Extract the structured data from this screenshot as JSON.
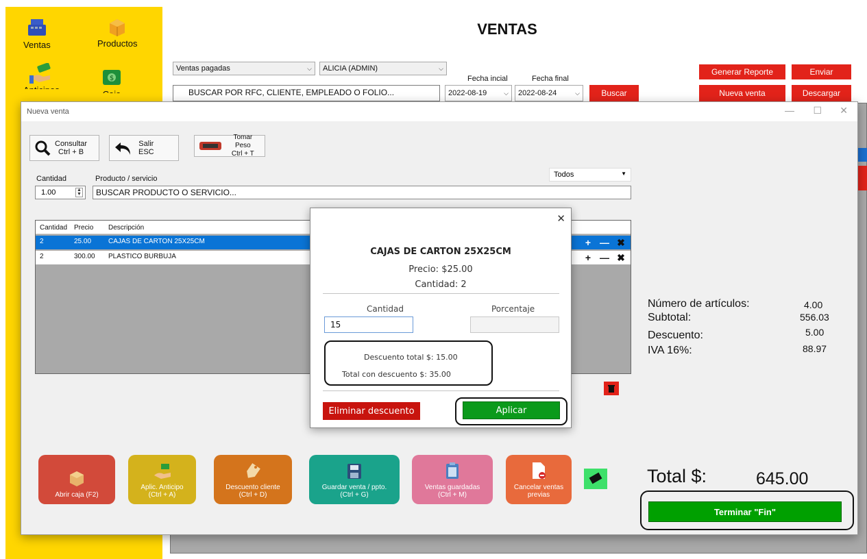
{
  "sidebar": {
    "items": [
      {
        "label": "Ventas",
        "icon": "cash-register-icon"
      },
      {
        "label": "Productos",
        "icon": "box-icon"
      },
      {
        "label": "Anticipos",
        "icon": "money-hand-icon"
      },
      {
        "label": "Caja",
        "icon": "cash-icon"
      }
    ]
  },
  "header": {
    "title": "VENTAS",
    "filter_select": "Ventas pagadas",
    "user_select": "ALICIA (ADMIN)",
    "search_placeholder": "BUSCAR POR RFC, CLIENTE, EMPLEADO O FOLIO...",
    "fecha_inicial_label": "Fecha incial",
    "fecha_final_label": "Fecha final",
    "fecha_inicial": "2022-08-19",
    "fecha_final": "2022-08-24",
    "buscar_label": "Buscar",
    "generar_reporte_label": "Generar Reporte",
    "enviar_label": "Enviar",
    "nueva_venta_label": "Nueva venta",
    "descargar_label": "Descargar"
  },
  "window": {
    "title": "Nueva venta",
    "toolbar": {
      "consultar_line1": "Consultar",
      "consultar_line2": "Ctrl + B",
      "salir_line1": "Salir",
      "salir_line2": "ESC",
      "peso_line1": "Tomar Peso",
      "peso_line2": "Ctrl + T"
    },
    "cantidad_label": "Cantidad",
    "cantidad_value": "1.00",
    "producto_label": "Producto / servicio",
    "producto_placeholder": "BUSCAR PRODUCTO O SERVICIO...",
    "categoria_select": "Todos",
    "grid": {
      "headers": [
        "Cantidad",
        "Precio",
        "Descripción"
      ],
      "rows": [
        {
          "cantidad": "2",
          "precio": "25.00",
          "descripcion": "CAJAS DE CARTON 25X25CM"
        },
        {
          "cantidad": "2",
          "precio": "300.00",
          "descripcion": "PLASTICO BURBUJA"
        }
      ]
    },
    "summary": {
      "articulos_label": "Número de artículos:",
      "articulos_value": "4.00",
      "subtotal_label": "Subtotal:",
      "subtotal_value": "556.03",
      "descuento_label": "Descuento:",
      "descuento_value": "5.00",
      "iva_label": "IVA 16%:",
      "iva_value": "88.97"
    },
    "actions": [
      {
        "line1": "Abrir caja (F2)",
        "line2": "",
        "color": "#d24a3a",
        "icon": "box-icon"
      },
      {
        "line1": "Aplic. Anticipo",
        "line2": "(Ctrl + A)",
        "color": "#d4b21c",
        "icon": "money-hand-icon"
      },
      {
        "line1": "Descuento cliente",
        "line2": "(Ctrl + D)",
        "color": "#d4741c",
        "icon": "tag-icon"
      },
      {
        "line1": "Guardar venta / ppto.",
        "line2": "(Ctrl + G)",
        "color": "#1aa38b",
        "icon": "save-icon"
      },
      {
        "line1": "Ventas guardadas",
        "line2": "(Ctrl + M)",
        "color": "#e0789a",
        "icon": "clipboard-icon"
      },
      {
        "line1": "Cancelar ventas",
        "line2": "previas",
        "color": "#e86a3c",
        "icon": "cancel-document-icon"
      }
    ],
    "total_label": "Total $:",
    "total_value": "645.00",
    "terminar_label": "Terminar \"Fin\""
  },
  "modal": {
    "product": "CAJAS DE CARTON 25X25CM",
    "precio": "Precio: $25.00",
    "cantidad": "Cantidad: 2",
    "cantidad_label": "Cantidad",
    "porcentaje_label": "Porcentaje",
    "cantidad_input": "15",
    "porcentaje_input": "",
    "descuento_total": "Descuento total $: 15.00",
    "total_con_descuento": "Total con descuento $: 35.00",
    "eliminar_label": "Eliminar descuento",
    "aplicar_label": "Aplicar"
  },
  "colors": {
    "sidebar": "#ffd600",
    "red": "#e2231a",
    "selected_row": "#0a74d6",
    "green": "#00a000"
  }
}
